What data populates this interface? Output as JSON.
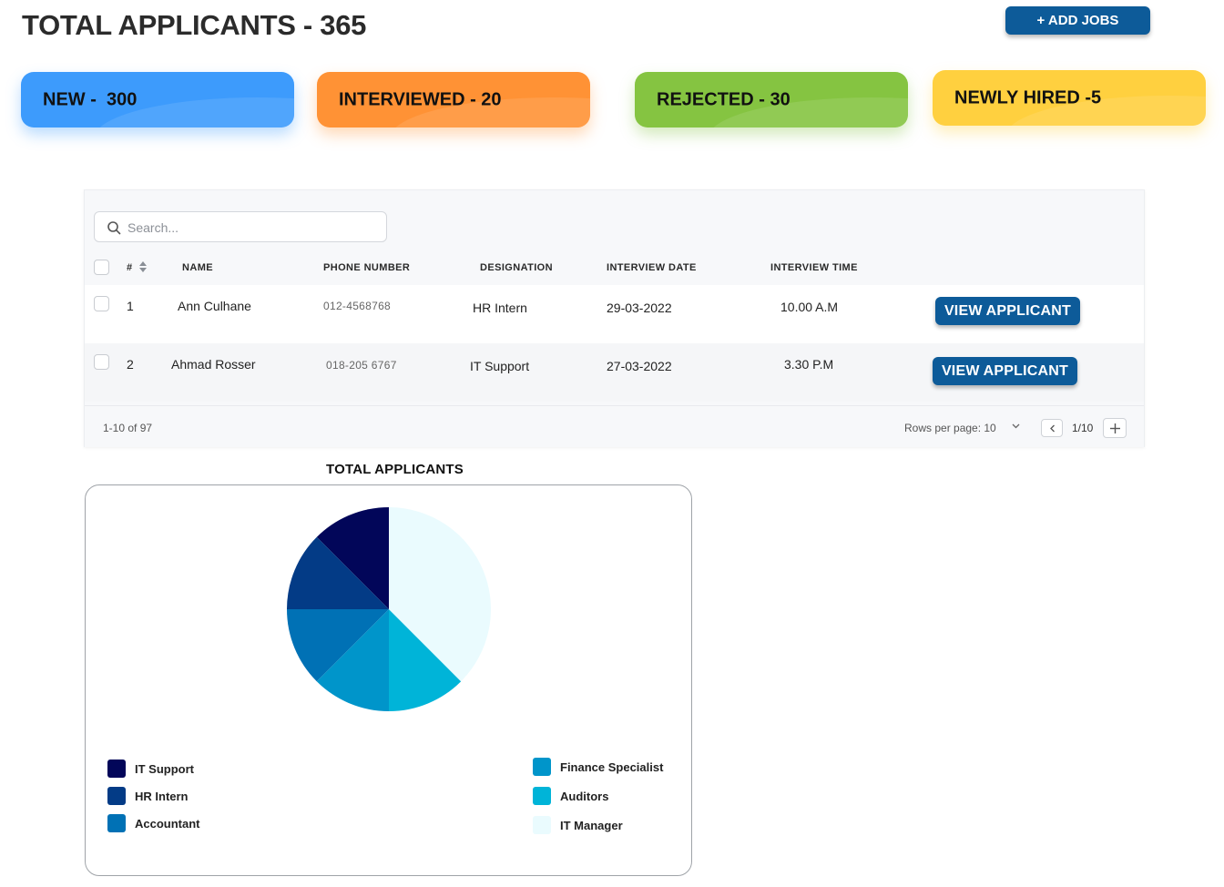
{
  "header": {
    "title": "TOTAL APPLICANTS - 365",
    "add_jobs_label": "+ ADD JOBS"
  },
  "stats": {
    "new": "NEW -  300",
    "interviewed": "INTERVIEWED - 20",
    "rejected": "REJECTED - 30",
    "hired": "NEWLY HIRED -5"
  },
  "colors": {
    "accent_button": "#0d5b99",
    "new": "#3d9bfc",
    "interviewed": "#ff9235",
    "rejected": "#85c441",
    "hired": "#ffd03f"
  },
  "table": {
    "search_placeholder": "Search...",
    "columns": {
      "index": "#",
      "name": "NAME",
      "phone": "PHONE NUMBER",
      "designation": "DESIGNATION",
      "date": "INTERVIEW DATE",
      "time": "INTERVIEW TIME"
    },
    "rows": [
      {
        "index": "1",
        "name": "Ann Culhane",
        "phone": "012-4568768",
        "designation": "HR Intern",
        "date": "29-03-2022",
        "time": "10.00 A.M",
        "action": "VIEW APPLICANT"
      },
      {
        "index": "2",
        "name": "Ahmad Rosser",
        "phone": "018-205 6767",
        "designation": "IT Support",
        "date": "27-03-2022",
        "time": "3.30 P.M",
        "action": "VIEW APPLICANT"
      }
    ],
    "footer": {
      "range": "1-10 of 97",
      "rows_per_page": "Rows per page: 10",
      "page": "1/10"
    },
    "icons": {
      "search": "search-icon",
      "sort": "sort-icon",
      "chevron": "chevron-down-icon",
      "prev": "chevron-left-icon",
      "next": "plus-icon"
    }
  },
  "chart": {
    "title": "TOTAL APPLICANTS",
    "legend": [
      {
        "label": "IT Support",
        "color": "#020659"
      },
      {
        "label": "HR Intern",
        "color": "#033b86"
      },
      {
        "label": "Accountant",
        "color": "#0071b5"
      },
      {
        "label": "Finance Specialist",
        "color": "#0095ca"
      },
      {
        "label": "Auditors",
        "color": "#00b4d8"
      },
      {
        "label": "IT Manager",
        "color": "#eafbfe"
      }
    ]
  },
  "chart_data": {
    "type": "pie",
    "categories": [
      "IT Support",
      "HR Intern",
      "Accountant",
      "Finance Specialist",
      "Auditors",
      "IT Manager"
    ],
    "values": [
      12.5,
      12.5,
      12.5,
      12.5,
      12.5,
      37.5
    ],
    "colors": [
      "#020659",
      "#033b86",
      "#0071b5",
      "#0095ca",
      "#00b4d8",
      "#eafbfe"
    ],
    "title": "TOTAL APPLICANTS",
    "legend_position": "bottom"
  }
}
